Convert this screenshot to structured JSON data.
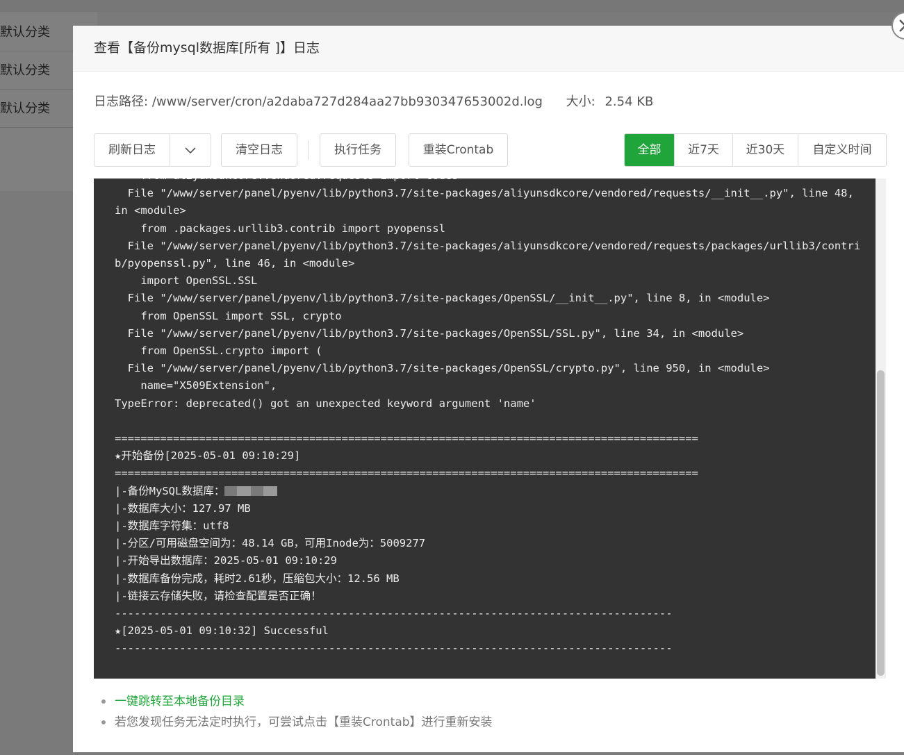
{
  "background": {
    "rows": [
      "默认分类",
      "默认分类",
      "默认分类"
    ]
  },
  "modal": {
    "title": "查看【备份mysql数据库[所有 ]】日志",
    "path_label": "日志路径:",
    "path_value": "/www/server/cron/a2daba727d284aa27bb930347653002d.log",
    "size_label": "大小:",
    "size_value": "2.54 KB",
    "toolbar": {
      "refresh_label": "刷新日志",
      "clear_label": "清空日志",
      "run_label": "执行任务",
      "reinstall_label": "重装Crontab",
      "filters": [
        "全部",
        "近7天",
        "近30天",
        "自定义时间"
      ],
      "active_filter": "全部"
    },
    "log_lines": [
      "    from aliyunsdkcore.vendored.requests import codes",
      "  File \"/www/server/panel/pyenv/lib/python3.7/site-packages/aliyunsdkcore/vendored/requests/__init__.py\", line 48, in <module>",
      "    from .packages.urllib3.contrib import pyopenssl",
      "  File \"/www/server/panel/pyenv/lib/python3.7/site-packages/aliyunsdkcore/vendored/requests/packages/urllib3/contrib/pyopenssl.py\", line 46, in <module>",
      "    import OpenSSL.SSL",
      "  File \"/www/server/panel/pyenv/lib/python3.7/site-packages/OpenSSL/__init__.py\", line 8, in <module>",
      "    from OpenSSL import SSL, crypto",
      "  File \"/www/server/panel/pyenv/lib/python3.7/site-packages/OpenSSL/SSL.py\", line 34, in <module>",
      "    from OpenSSL.crypto import (",
      "  File \"/www/server/panel/pyenv/lib/python3.7/site-packages/OpenSSL/crypto.py\", line 950, in <module>",
      "    name=\"X509Extension\",",
      "TypeError: deprecated() got an unexpected keyword argument 'name'",
      "",
      "==========================================================================================",
      "★开始备份[2025-05-01 09:10:29]",
      "==========================================================================================",
      "|-备份MySQL数据库：",
      "|-数据库大小：127.97 MB",
      "|-数据库字符集：utf8",
      "|-分区/可用磁盘空间为：48.14 GB，可用Inode为：5009277",
      "|-开始导出数据库：2025-05-01 09:10:29",
      "|-数据库备份完成，耗时2.61秒，压缩包大小：12.56 MB",
      "|-链接云存储失败，请检查配置是否正确！",
      "--------------------------------------------------------------------------------------",
      "★[2025-05-01 09:10:32] Successful",
      "--------------------------------------------------------------------------------------"
    ],
    "tips": {
      "link": "一键跳转至本地备份目录",
      "note": "若您发现任务无法定时执行，可尝试点击【重装Crontab】进行重新安装"
    }
  },
  "colors": {
    "accent": "#20a53a",
    "log_bg": "#333333"
  }
}
